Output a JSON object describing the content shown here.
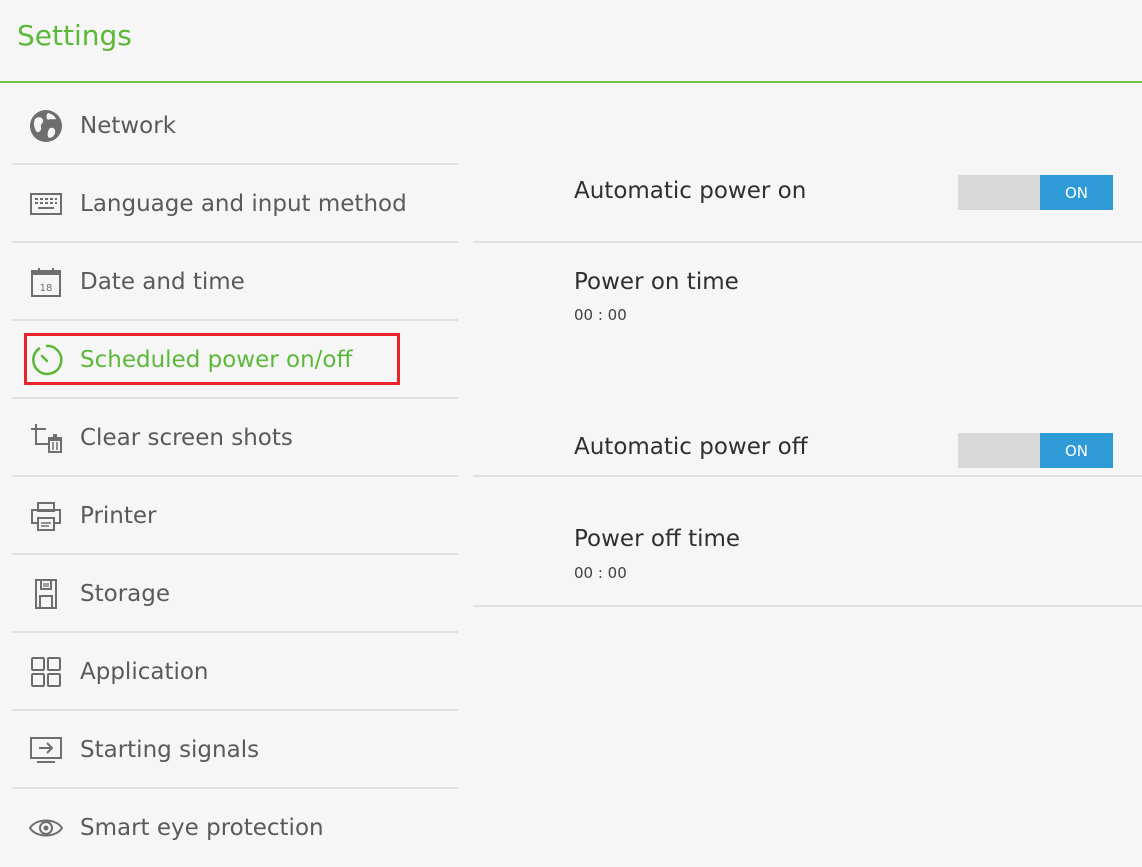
{
  "header": {
    "title": "Settings"
  },
  "sidebar": {
    "items": [
      {
        "label": "Network",
        "icon": "globe-icon"
      },
      {
        "label": "Language and input method",
        "icon": "keyboard-icon"
      },
      {
        "label": "Date and time",
        "icon": "calendar-icon",
        "icon_text": "18"
      },
      {
        "label": "Scheduled power on/off",
        "icon": "timer-icon",
        "selected": true
      },
      {
        "label": "Clear screen shots",
        "icon": "crop-trash-icon"
      },
      {
        "label": "Printer",
        "icon": "printer-icon"
      },
      {
        "label": "Storage",
        "icon": "sd-card-icon"
      },
      {
        "label": "Application",
        "icon": "apps-grid-icon"
      },
      {
        "label": "Starting signals",
        "icon": "input-signal-icon"
      },
      {
        "label": "Smart eye protection",
        "icon": "eye-icon"
      }
    ]
  },
  "content": {
    "auto_power_on": {
      "label": "Automatic power on",
      "toggle": "ON"
    },
    "power_on_time": {
      "label": "Power on time",
      "value": "00 : 00"
    },
    "auto_power_off": {
      "label": "Automatic power off",
      "toggle": "ON"
    },
    "power_off_time": {
      "label": "Power off time",
      "value": "00 : 00"
    }
  },
  "colors": {
    "accent_green": "#5cb839",
    "toggle_blue": "#2e9ad6",
    "selection_box_red": "#e8232b"
  }
}
